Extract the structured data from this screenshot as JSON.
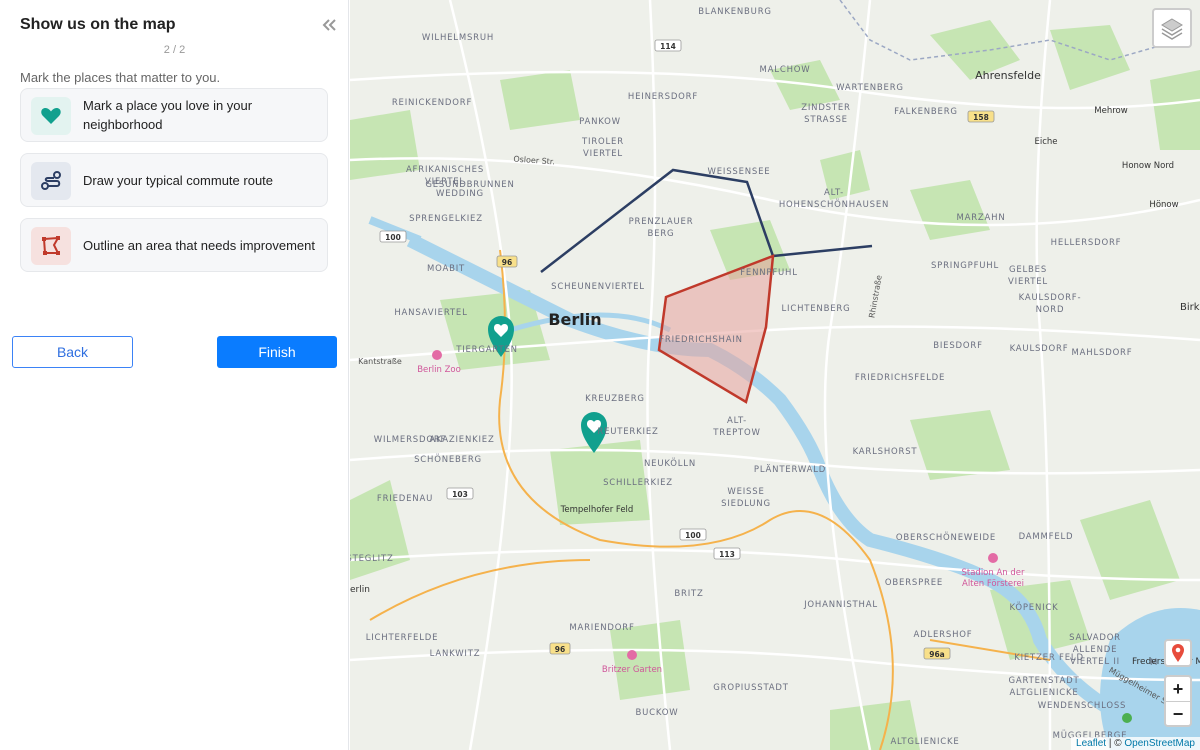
{
  "sidebar": {
    "title": "Show us on the map",
    "collapse_icon": "double-chevron-left-icon",
    "step": "2 / 2",
    "instruction": "Mark the places that matter to you.",
    "options": [
      {
        "label": "Mark a place you love in your neighborhood",
        "icon": "heart-icon",
        "color": "#11a08e",
        "bg": "#e3f3f0"
      },
      {
        "label": "Draw your typical commute route",
        "icon": "route-icon",
        "color": "#2c3e63",
        "bg": "#e4e8ef"
      },
      {
        "label": "Outline an area that needs improvement",
        "icon": "polygon-icon",
        "color": "#c0392b",
        "bg": "#f6e1df"
      }
    ],
    "back_label": "Back",
    "finish_label": "Finish"
  },
  "map": {
    "city_label": "Berlin",
    "districts": [
      "Blankenburg",
      "Wilhelmsruh",
      "Malchow",
      "Ahrensfelde",
      "Reinickendorf",
      "Heinersdorf",
      "Wartenberg",
      "Zindster Strasse",
      "Falkenberg",
      "Mehrow",
      "Pankow",
      "Tiroler Viertel",
      "Eiche",
      "Afrikanisches Viertel",
      "Weissensee",
      "Alt-Hohenschönhausen",
      "Honow Nord",
      "Wedding",
      "Gesundbrunnen",
      "Hönow",
      "Sprengelkiez",
      "Prenzlauer Berg",
      "Marzahn",
      "Hellersdorf",
      "Moabit",
      "Fennpfuhl",
      "Springpfuhl",
      "Gelbes Viertel",
      "Schеunenviertel",
      "Kaulsdorf-Nord",
      "Hansaviertel",
      "Lichtenberg",
      "Tiergarten",
      "Friedrichshain",
      "Biesdorf",
      "Kaulsdorf",
      "Mahlsdorf",
      "Friedrichsfelde",
      "Kreuzberg",
      "Alt-Treptow",
      "Wilmersdorf",
      "Akazienkiez",
      "Reuterkiez",
      "Karlshorst",
      "Schöneberg",
      "Neukölln",
      "Plänterwald",
      "Schillerkiez",
      "Weisse Siedlung",
      "Friedenau",
      "Tempelhofer Feld",
      "Dammfeld",
      "Oberschöneweide",
      "Steglitz",
      "Oberspree",
      "Köpenick",
      "Britz",
      "Johannisthal",
      "Fredersdorfer Mühle",
      "Salvador Allende Viertel",
      "Adlershof",
      "Lichterfelde",
      "Mariendorf",
      "Lankwitz",
      "Kietzer Feld",
      "Gartenstadt Altglienicke",
      "Gropiusstadt",
      "Wendenschloss",
      "Buckow",
      "Altglienicke",
      "Müggelberge"
    ],
    "street_labels": [
      "Osloer Str.",
      "Kantstraße",
      "Rhinstraße",
      "Müggelheimer Str."
    ],
    "road_shields": [
      "114",
      "158",
      "100",
      "96",
      "103",
      "100",
      "113",
      "96",
      "96a"
    ],
    "poi_labels": [
      "Berlin Zoo",
      "Stadion An der Alten Försterei",
      "Britzer Garten"
    ],
    "edge_labels": [
      "Birk",
      "erlin",
      "Fredersdorfer M"
    ],
    "layers_icon": "layers-icon",
    "pin_icon": "map-pin-icon",
    "zoom_in": "+",
    "zoom_out": "−",
    "attribution": {
      "leaflet": "Leaflet",
      "separator": " | © ",
      "osm": "OpenStreetMap"
    },
    "colors": {
      "route": "#2c3e63",
      "area_stroke": "#c0392b",
      "area_fill": "#e8a29c",
      "marker": "#11a08e",
      "water": "#a8d4ec",
      "park": "#c6e5b3"
    }
  }
}
